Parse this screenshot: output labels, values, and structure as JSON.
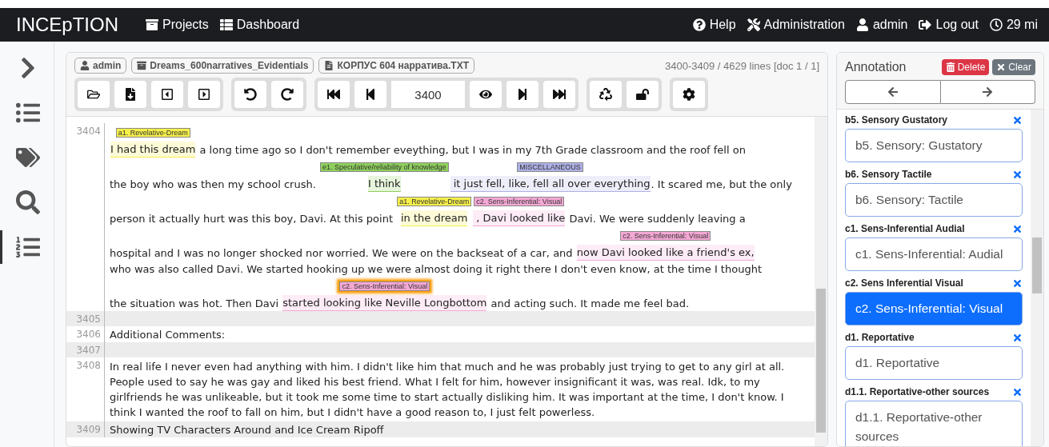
{
  "navbar": {
    "brand": "INCEpTION",
    "left": [
      {
        "label": "Projects"
      },
      {
        "label": "Dashboard"
      }
    ],
    "right": [
      {
        "label": "Help"
      },
      {
        "label": "Administration"
      },
      {
        "label": "admin"
      },
      {
        "label": "Log out"
      },
      {
        "label": "29 mi"
      }
    ]
  },
  "sidebar": {
    "items": [
      {
        "selected": false
      },
      {
        "selected": false
      },
      {
        "selected": false
      },
      {
        "selected": false
      },
      {
        "selected": true
      }
    ]
  },
  "document": {
    "breadcrumbs": [
      "admin",
      "Dreams_600narratives_Evidentials",
      "КОРПУС 604 нарратива.TXT"
    ],
    "position": "3400-3409 / 4629 lines [doc 1 / 1]",
    "page_field": {
      "value": "3400"
    },
    "lines": [
      {
        "number": "3404",
        "rows": [
          [
            {
              "text": "I had this dream",
              "label": "a1. Revelative-Dream",
              "color": "#f5ef4a",
              "selected": false
            },
            {
              "text": " a long time ago so I don't remember eveything, but I was in my 7th Grade classroom and the roof fell on"
            }
          ],
          [
            {
              "text": "the boy who was then my school crush. "
            },
            {
              "text": "I think",
              "label": "e1. Speculative/reliability of knowledge",
              "color": "#8fd05c",
              "selected": false
            },
            {
              "text": " it just fell, like, fell all over everything",
              "label": "MISCELLANEOUS",
              "color": "#aeb0e6",
              "selected": false
            },
            {
              "text": ". It scared me, but the only"
            }
          ],
          [
            {
              "text": "person it actually hurt was this boy, Davi. At this point "
            },
            {
              "text": "in the dream",
              "label": "a1. Revelative-Dream",
              "color": "#f5ef4a",
              "selected": false
            },
            {
              "text": " , Davi looked like",
              "label": "c2. Sens-Inferential: Visual",
              "color": "#f4a8d4",
              "selected": false
            },
            {
              "text": " Davi. We were suddenly leaving a"
            }
          ],
          [
            {
              "text": "hospital and I was no longer shocked nor worried. We were on the backseat of a car, and "
            },
            {
              "text": "now Davi looked like a friend's ex,",
              "label": "c2. Sens-Inferential: Visual",
              "color": "#f4a8d4",
              "selected": false
            }
          ],
          [
            {
              "text": "who was also called Davi. We started hooking up we were almost doing it right there I don't even know, at the time I thought"
            }
          ],
          [
            {
              "text": "the situation was hot. Then Davi "
            },
            {
              "text": "started looking like Neville Longbottom",
              "label": "c2. Sens-Inferential: Visual",
              "color": "#f4a8d4",
              "selected": true
            },
            {
              "text": " and acting such. It made me feel bad."
            }
          ]
        ]
      },
      {
        "number": "3405"
      },
      {
        "number": "3406",
        "rows": [
          [
            {
              "text": "Additional Comments:"
            }
          ]
        ]
      },
      {
        "number": "3407"
      },
      {
        "number": "3408",
        "paragraph": "In real life I never even had anything with him. I didn't like him that much and he was probably just trying to get to any girl at all. People used to say he was gay and liked his best friend. What I felt for him, however insignificant it was, was real. Idk, to my girlfriends he was unlikeable, but it took me some time to start actually disliking him. It was important at the time, I don't know. I think I wanted the roof to fall on him, but I didn't have a good reason to, I just felt powerless."
      },
      {
        "number": "3409",
        "rows": [
          [
            {
              "text": "Showing TV Characters Around and Ice Cream Ripoff"
            }
          ]
        ]
      }
    ]
  },
  "annotation_panel": {
    "title": "Annotation",
    "buttons": [
      "Delete",
      "Clear"
    ],
    "features": [
      {
        "name": "b5. Sensory Gustatory",
        "value": "b5. Sensory: Gustatory",
        "selected": false
      },
      {
        "name": "b6. Sensory Tactile",
        "value": "b6. Sensory: Tactile",
        "selected": false
      },
      {
        "name": "c1. Sens-Inferential Audial",
        "value": "c1. Sens-Inferential: Audial",
        "selected": false
      },
      {
        "name": "c2. Sens Inferential Visual",
        "value": "c2. Sens-Inferential: Visual",
        "selected": true
      },
      {
        "name": "d1. Reportative",
        "value": "d1. Reportative",
        "selected": false
      },
      {
        "name": "d1.1. Reportative-other sources",
        "value": "d1.1. Reportative-other sources",
        "selected": false
      }
    ]
  }
}
